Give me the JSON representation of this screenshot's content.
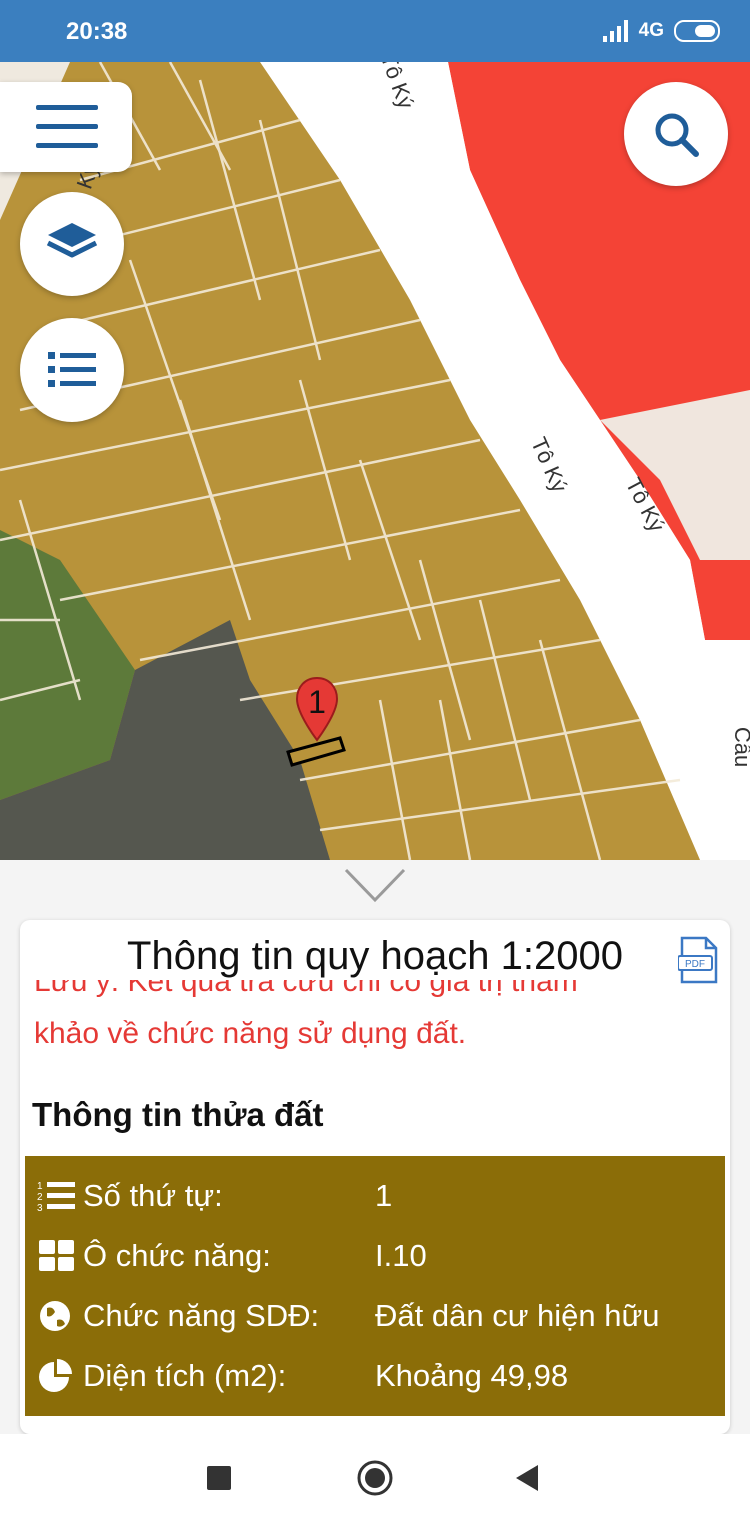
{
  "status_bar": {
    "time": "20:38",
    "network": "4G"
  },
  "map": {
    "road_labels": [
      "Tô Ký",
      "Tô Ký",
      "Tô Ký",
      "Cầu",
      "Tô Ký",
      "Tô Ký"
    ],
    "marker_label": "1",
    "colors": {
      "residential": "#b8933a",
      "red_zone": "#f44336",
      "green": "#5d7a3a",
      "dark": "#55574f"
    }
  },
  "buttons": {
    "menu": "menu-icon",
    "layers": "layers-icon",
    "list": "list-icon",
    "search": "search-icon"
  },
  "info_card": {
    "title": "Thông tin quy hoạch 1:2000",
    "pdf_icon": "pdf-icon",
    "note_line1": "Lưu ý: Kết quả tra cứu chỉ có giá trị tham",
    "note_line2": "khảo về chức năng sử dụng đất.",
    "section_heading": "Thông tin thửa đất",
    "rows": [
      {
        "icon": "ordered-list-icon",
        "label": "Số thứ tự:",
        "value": "1"
      },
      {
        "icon": "grid-icon",
        "label": "Ô chức năng:",
        "value": "I.10"
      },
      {
        "icon": "globe-icon",
        "label": "Chức năng SDĐ:",
        "value": "Đất dân cư hiện hữu"
      },
      {
        "icon": "pie-chart-icon",
        "label": "Diện tích (m2):",
        "value": "Khoảng 49,98"
      }
    ],
    "panel_color": "#8b6d08"
  },
  "nav_bar": {
    "buttons": [
      "recents-button",
      "home-button",
      "back-button"
    ]
  }
}
